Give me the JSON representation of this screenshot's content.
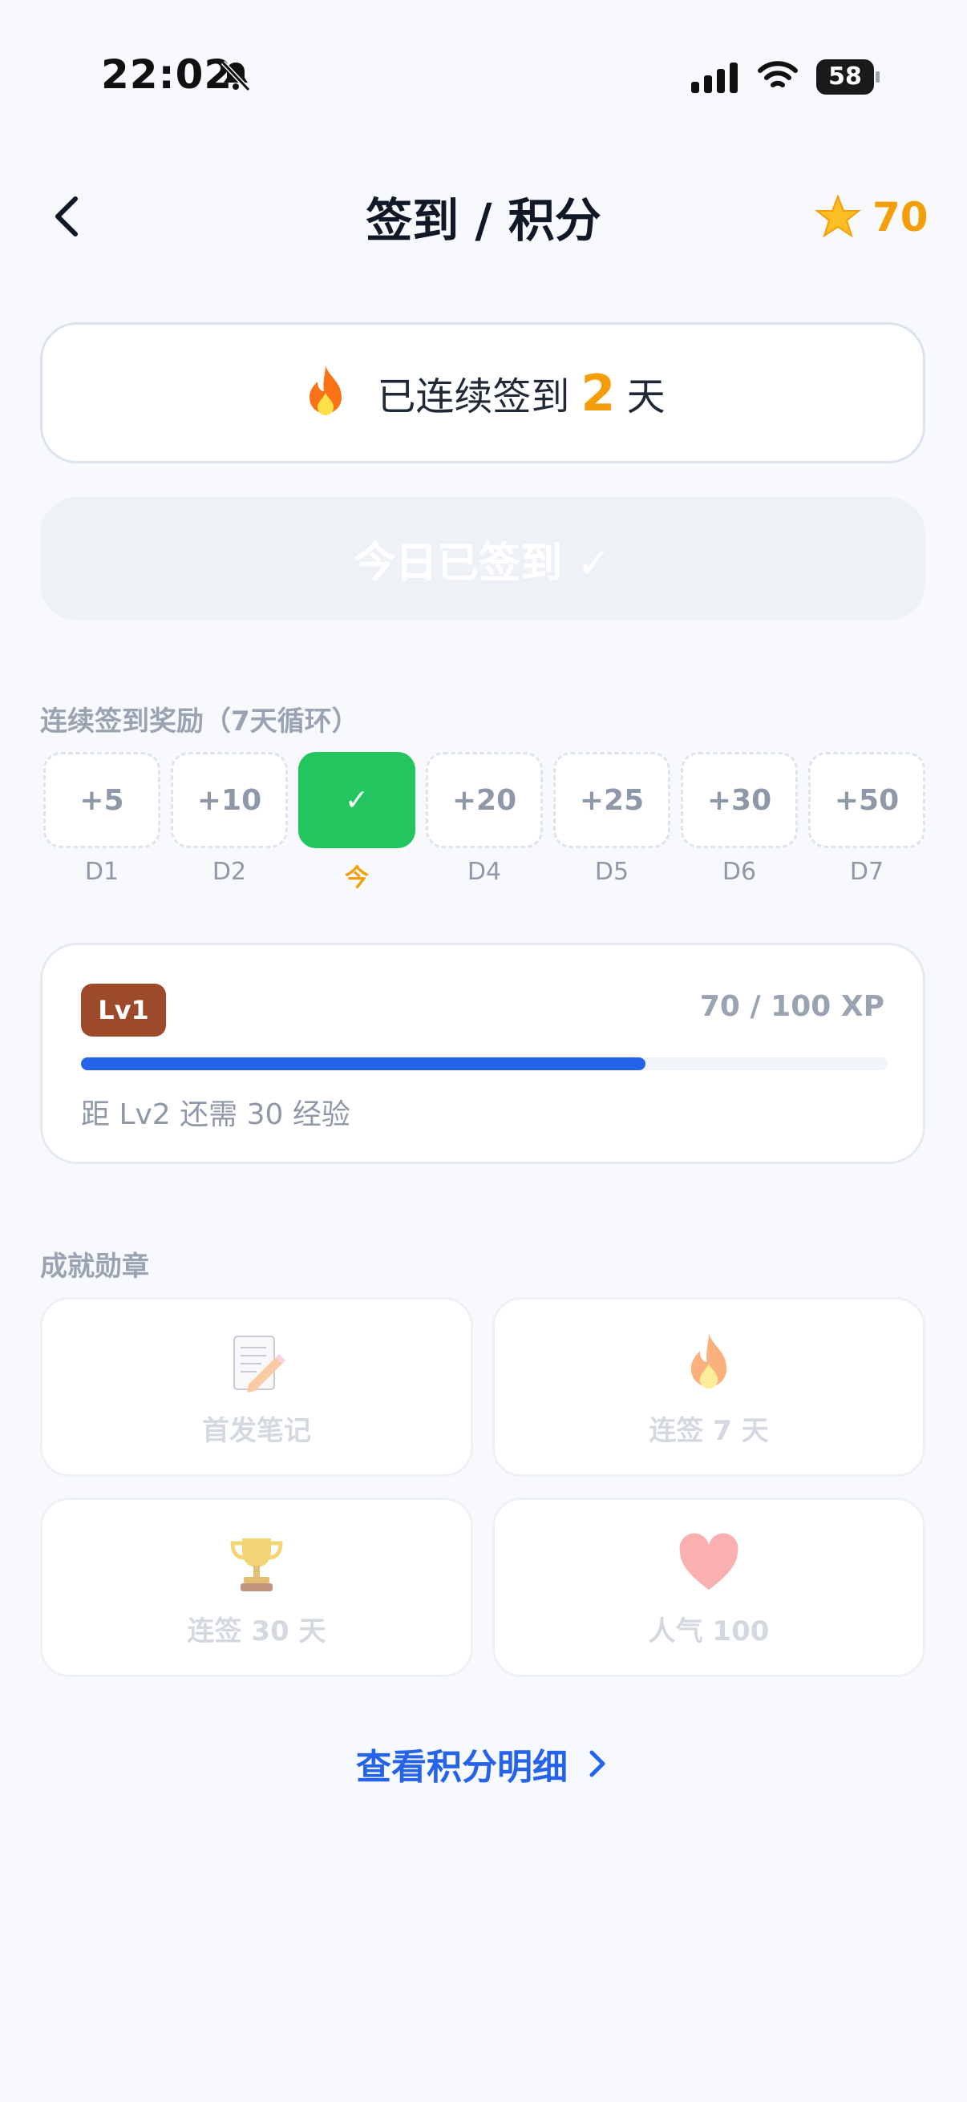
{
  "status_bar": {
    "time": "22:02",
    "battery": "58"
  },
  "header": {
    "title": "签到 / 积分",
    "points": "70"
  },
  "streak": {
    "prefix": "已连续签到",
    "days": "2",
    "suffix": "天"
  },
  "checkin_button": {
    "label": "今日已签到 ✓"
  },
  "rewards": {
    "section_title": "连续签到奖励（7天循环）",
    "days": [
      {
        "value": "+5",
        "label": "D1",
        "today": false
      },
      {
        "value": "+10",
        "label": "D2",
        "today": false
      },
      {
        "value": "✓",
        "label": "今",
        "today": true
      },
      {
        "value": "+20",
        "label": "D4",
        "today": false
      },
      {
        "value": "+25",
        "label": "D5",
        "today": false
      },
      {
        "value": "+30",
        "label": "D6",
        "today": false
      },
      {
        "value": "+50",
        "label": "D7",
        "today": false
      }
    ]
  },
  "level": {
    "badge": "Lv1",
    "xp_text": "70 / 100 XP",
    "progress": 0.7,
    "next_text": "距 Lv2 还需 30 经验"
  },
  "achievements": {
    "section_title": "成就勋章",
    "items": [
      {
        "icon": "memo-icon",
        "label": "首发笔记"
      },
      {
        "icon": "fire-icon",
        "label": "连签 7 天"
      },
      {
        "icon": "trophy-icon",
        "label": "连签 30 天"
      },
      {
        "icon": "heart-icon",
        "label": "人气 100"
      }
    ]
  },
  "footer": {
    "link_label": "查看积分明细"
  },
  "colors": {
    "accent": "#2563eb",
    "points": "#f59e0b",
    "success": "#22c55e",
    "level_badge": "#9c4a2a"
  }
}
